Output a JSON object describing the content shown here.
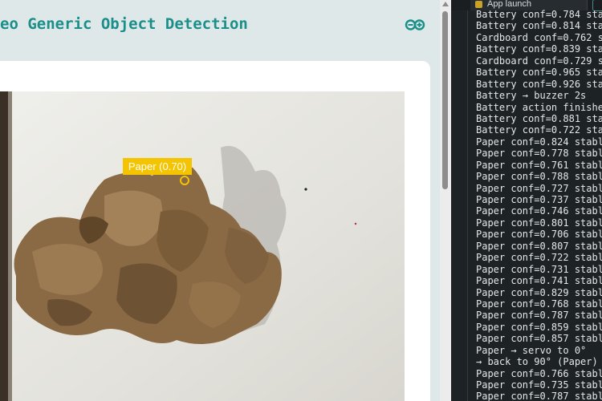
{
  "app": {
    "title": "eo Generic Object Detection",
    "logo_icon": "arduino-infinity-logo-icon",
    "accent_color": "#1a8e88"
  },
  "detection": {
    "label": "Paper (0.70)",
    "box_color": "#f5c400"
  },
  "terminal": {
    "tab_label": "App launch",
    "lines": [
      "Battery conf=0.784 sta",
      "Battery conf=0.814 sta",
      "Cardboard conf=0.762 s",
      "Battery conf=0.839 sta",
      "Cardboard conf=0.729 s",
      "Battery conf=0.965 sta",
      "Battery conf=0.926 sta",
      "Battery → buzzer 2s",
      "Battery action finishe",
      "Battery conf=0.881 sta",
      "Battery conf=0.722 sta",
      "Paper conf=0.824 stabl",
      "Paper conf=0.778 stabl",
      "Paper conf=0.761 stabl",
      "Paper conf=0.788 stabl",
      "Paper conf=0.727 stabl",
      "Paper conf=0.737 stabl",
      "Paper conf=0.746 stabl",
      "Paper conf=0.801 stabl",
      "Paper conf=0.706 stabl",
      "Paper conf=0.807 stabl",
      "Paper conf=0.722 stabl",
      "Paper conf=0.731 stabl",
      "Paper conf=0.741 stabl",
      "Paper conf=0.829 stabl",
      "Paper conf=0.768 stabl",
      "Paper conf=0.787 stabl",
      "Paper conf=0.859 stabl",
      "Paper conf=0.857 stabl",
      "Paper → servo to 0°",
      "→ back to 90° (Paper)",
      "Paper conf=0.766 stabl",
      "Paper conf=0.735 stabl",
      "Paper conf=0.787 stabl"
    ]
  }
}
